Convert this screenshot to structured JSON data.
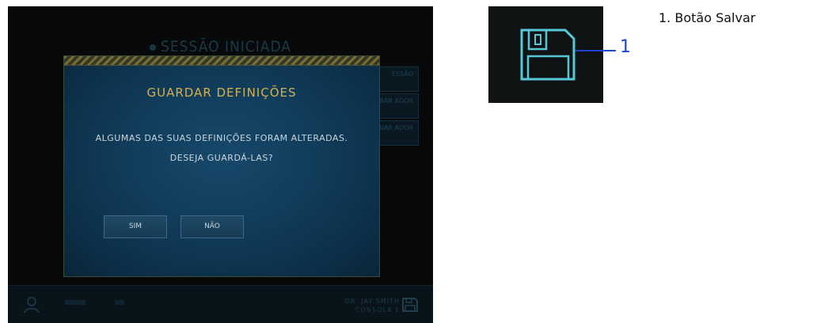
{
  "screen": {
    "background_title": "SESSÃO INICIADA",
    "side_buttons": [
      "ESSÃO",
      "BAR ADOR",
      "NAR ADOR"
    ],
    "dialog": {
      "title": "GUARDAR DEFINIÇÕES",
      "message_line1": "ALGUMAS DAS SUAS DEFINIÇÕES FORAM ALTERADAS.",
      "message_line2": "DESEJA GUARDÁ-LAS?",
      "yes_label": "SIM",
      "no_label": "NÃO"
    },
    "status_bar": {
      "user_name": "DR. JAY SMITH",
      "console_name": "CONSOLA 1"
    }
  },
  "callout": {
    "number": "1"
  },
  "legend": {
    "item1": "1.  Botão Salvar"
  },
  "colors": {
    "accent_gold": "#d6b04a",
    "callout_blue": "#1c46d4",
    "icon_cyan": "#56c8d8"
  },
  "icons": [
    "user-icon",
    "save-icon",
    "floppy-disk-icon"
  ]
}
